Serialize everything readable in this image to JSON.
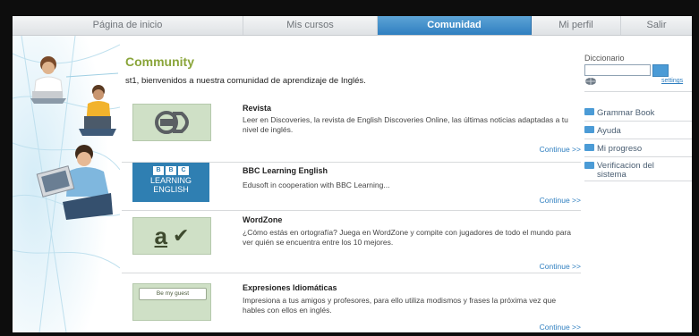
{
  "nav": {
    "items": [
      {
        "label": "Página de inicio"
      },
      {
        "label": "Mis cursos"
      },
      {
        "label": "Comunidad"
      },
      {
        "label": "Mi perfil"
      },
      {
        "label": "Salir"
      }
    ],
    "active_index": 2
  },
  "main": {
    "title": "Community",
    "welcome": "st1, bienvenidos a nuestra comunidad de aprendizaje de Inglés.",
    "items": [
      {
        "name": "Revista",
        "desc": "Leer en Discoveries, la revista de English Discoveries Online, las últimas noticias adaptadas a tu nivel de inglés.",
        "continue": "Continue >>"
      },
      {
        "name": "BBC Learning English",
        "desc": "Edusoft in cooperation with BBC Learning...",
        "continue": "Continue >>",
        "logo_lines": [
          "BBC",
          "LEARNING",
          "ENGLISH"
        ]
      },
      {
        "name": "WordZone",
        "desc": "¿Cómo estás en ortografía? Juega en WordZone y compite con jugadores de todo el mundo para ver quién se encuentra entre los 10 mejores.",
        "continue": "Continue >>",
        "logo_text": "a"
      },
      {
        "name": "Expresiones Idiomáticas",
        "desc": "Impresiona a tus amigos y profesores, para ello  utiliza modismos y frases la próxima vez que hables con ellos en inglés.",
        "continue": "Continue >>",
        "logo_text": "Be my guest"
      }
    ]
  },
  "sidebar": {
    "dictionary_label": "Diccionario",
    "search_value": "",
    "settings_label": "settings",
    "links": [
      {
        "label": "Grammar Book"
      },
      {
        "label": "Ayuda"
      },
      {
        "label": "Mi progreso"
      },
      {
        "label": "Verificacion del sistema"
      }
    ]
  },
  "colors": {
    "accent_blue": "#2f7fc0",
    "title_green": "#8aa53a",
    "thumb_green": "#cfe0c6"
  }
}
